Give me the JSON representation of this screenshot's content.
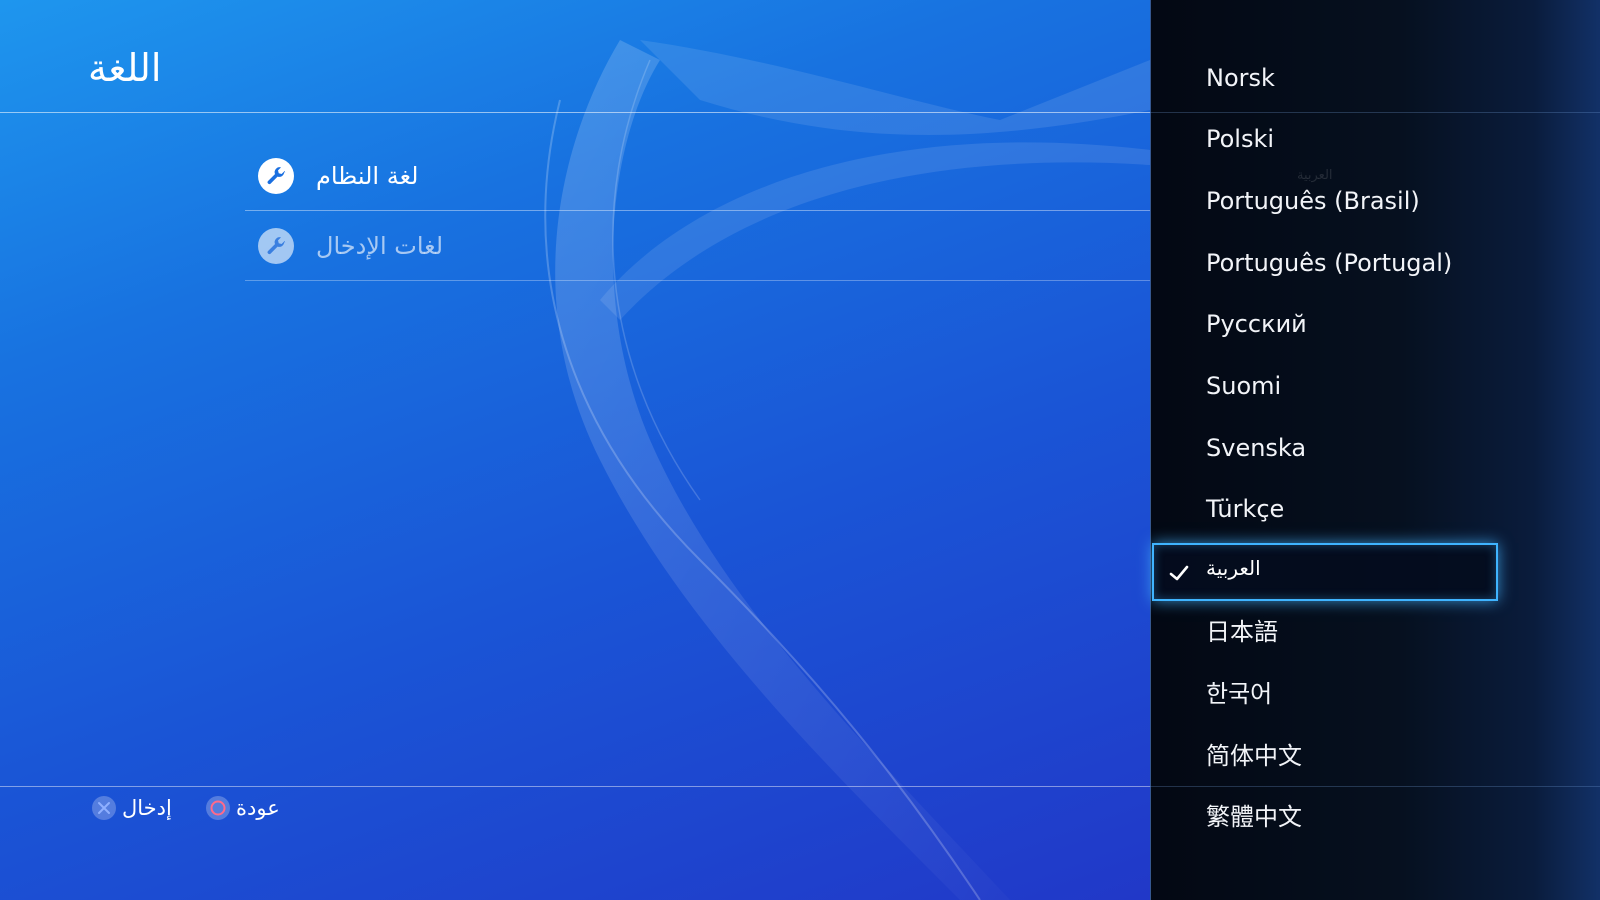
{
  "header": {
    "title": "اللغة"
  },
  "menu": [
    {
      "label": "لغة النظام",
      "icon": "wrench-icon",
      "enabled": true
    },
    {
      "label": "لغات الإدخال",
      "icon": "wrench-icon",
      "enabled": false
    }
  ],
  "footer": {
    "enter_label": "إدخال",
    "enter_icon": "cross-button-icon",
    "back_label": "عودة",
    "back_icon": "circle-button-icon"
  },
  "language_list": {
    "items": [
      "Norsk",
      "Polski",
      "Português (Brasil)",
      "Português (Portugal)",
      "Русский",
      "Suomi",
      "Svenska",
      "Türkçe",
      "العربية",
      "日本語",
      "한국어",
      "简体中文",
      "繁體中文"
    ],
    "selected": "العربية",
    "ghost_text": "العربية"
  },
  "colors": {
    "accent": "#3fb4ff",
    "bg_top": "#1e96ee",
    "bg_bottom": "#2138c8",
    "panel": "#06101f",
    "cross_button": "#8fb0ff",
    "circle_button": "#ff6a8a"
  }
}
